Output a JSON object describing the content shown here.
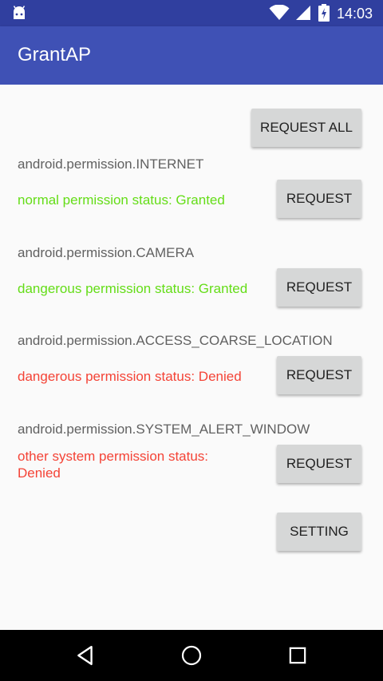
{
  "status_bar": {
    "time": "14:03",
    "icons": [
      "android-icon",
      "wifi-icon",
      "signal-icon",
      "battery-icon"
    ]
  },
  "app_bar": {
    "title": "GrantAP",
    "color": "#3f51b5"
  },
  "main": {
    "request_all_label": "REQUEST ALL",
    "permissions": [
      {
        "name": "android.permission.INTERNET",
        "status": "normal permission status: Granted",
        "status_color": "#64dd17",
        "button_label": "REQUEST"
      },
      {
        "name": "android.permission.CAMERA",
        "status": "dangerous permission status: Granted",
        "status_color": "#64dd17",
        "button_label": "REQUEST"
      },
      {
        "name": "android.permission.ACCESS_COARSE_LOCATION",
        "status": "dangerous permission status: Denied",
        "status_color": "#f44336",
        "button_label": "REQUEST"
      },
      {
        "name": "android.permission.SYSTEM_ALERT_WINDOW",
        "status_line1": "other system permission status:",
        "status_line2": "Denied",
        "status_color": "#f44336",
        "button_label": "REQUEST"
      }
    ],
    "setting_label": "SETTING"
  },
  "nav_bar": {
    "icons": [
      "back-icon",
      "home-icon",
      "recents-icon"
    ]
  }
}
